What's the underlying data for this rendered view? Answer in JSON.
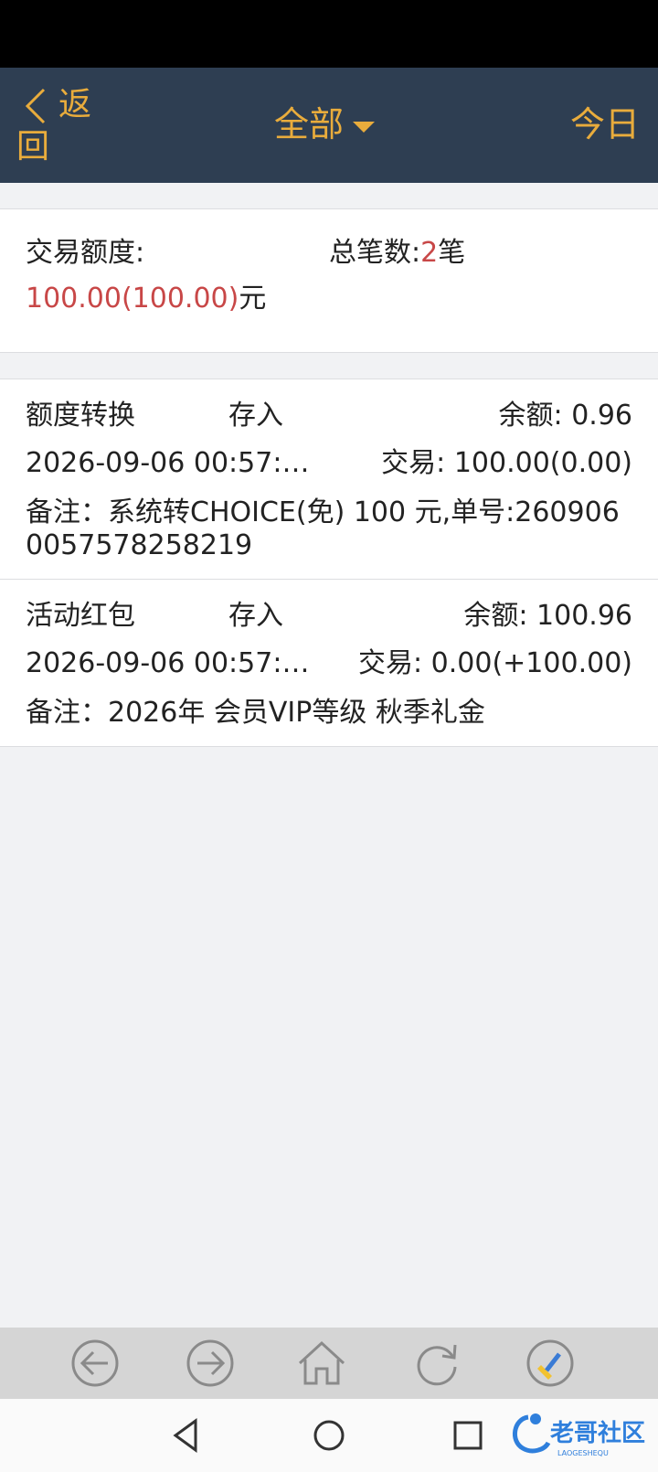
{
  "header": {
    "back_label": "返回",
    "filter_label": "全部",
    "today_label": "今日"
  },
  "summary": {
    "amount_label": "交易额度:",
    "amount_value": "100.00(100.00)",
    "amount_unit": "元",
    "count_label": "总笔数:",
    "count_value": "2",
    "count_unit": "笔"
  },
  "records": [
    {
      "type": "额度转换",
      "direction": "存入",
      "balance": "余额: 0.96",
      "time": "2026-09-06 00:57:…",
      "trade": "交易: 100.00(0.00)",
      "note": "备注：系统转CHOICE(免) 100 元,单号:2609060057578258219"
    },
    {
      "type": "活动红包",
      "direction": "存入",
      "balance": "余额: 100.96",
      "time": "2026-09-06 00:57:…",
      "trade": "交易: 0.00(+100.00)",
      "note": "备注：2026年 会员VIP等级 秋季礼金"
    }
  ],
  "toolbar": {
    "icons": [
      "back-arrow-icon",
      "forward-arrow-icon",
      "home-icon",
      "refresh-icon",
      "brush-icon"
    ]
  },
  "watermark": {
    "text": "老哥社区",
    "subtext": "LAOGESHEQU"
  },
  "colors": {
    "accent": "#e9ac3c",
    "navbar": "#2e3e52",
    "highlight": "#c84747"
  }
}
